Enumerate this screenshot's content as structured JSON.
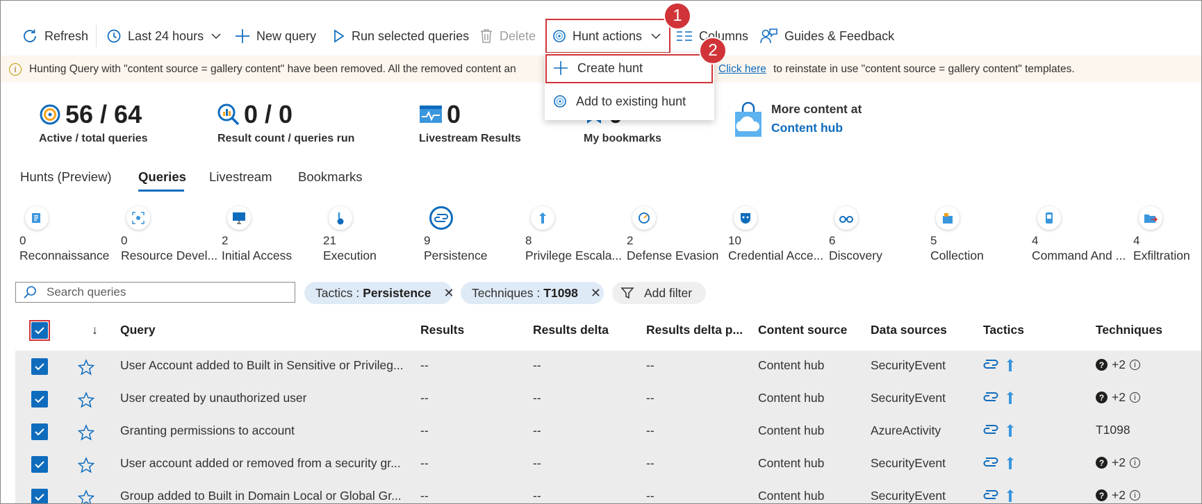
{
  "toolbar": {
    "refresh": "Refresh",
    "time_range": "Last 24 hours",
    "new_query": "New query",
    "run_selected": "Run selected queries",
    "delete": "Delete",
    "hunt_actions": "Hunt actions",
    "columns": "Columns",
    "guides": "Guides & Feedback"
  },
  "callouts": [
    "1",
    "2"
  ],
  "banner": {
    "text_before": "Hunting Query with \"content source = gallery content\" have been removed. All the removed content an",
    "link": "Click here",
    "text_after": "to reinstate in use \"content source = gallery content\" templates."
  },
  "hunt_menu": {
    "items": [
      "Create hunt",
      "Add to existing hunt"
    ]
  },
  "stats": {
    "active": {
      "value": "56 / 64",
      "label": "Active / total queries"
    },
    "results": {
      "value": "0 / 0",
      "label": "Result count / queries run"
    },
    "livestream": {
      "value": "0",
      "label": "Livestream Results"
    },
    "bookmarks": {
      "value": "0",
      "label": "My bookmarks"
    },
    "content_hub": {
      "line1": "More content at",
      "link": "Content hub"
    }
  },
  "tabs": [
    "Hunts (Preview)",
    "Queries",
    "Livestream",
    "Bookmarks"
  ],
  "active_tab": "Queries",
  "tactics": [
    {
      "count": "0",
      "name": "Reconnaissance",
      "icon": "reconnaissance-icon"
    },
    {
      "count": "0",
      "name": "Resource Devel...",
      "icon": "resource-development-icon"
    },
    {
      "count": "2",
      "name": "Initial Access",
      "icon": "initial-access-icon"
    },
    {
      "count": "21",
      "name": "Execution",
      "icon": "execution-icon"
    },
    {
      "count": "9",
      "name": "Persistence",
      "icon": "persistence-icon"
    },
    {
      "count": "8",
      "name": "Privilege Escala...",
      "icon": "privilege-escalation-icon"
    },
    {
      "count": "2",
      "name": "Defense Evasion",
      "icon": "defense-evasion-icon"
    },
    {
      "count": "10",
      "name": "Credential Acce...",
      "icon": "credential-access-icon"
    },
    {
      "count": "6",
      "name": "Discovery",
      "icon": "discovery-icon"
    },
    {
      "count": "5",
      "name": "Collection",
      "icon": "collection-icon"
    },
    {
      "count": "4",
      "name": "Command And ...",
      "icon": "command-and-control-icon"
    },
    {
      "count": "4",
      "name": "Exfiltration",
      "icon": "exfiltration-icon"
    }
  ],
  "filters": {
    "search_placeholder": "Search queries",
    "tactics_key": "Tactics :",
    "tactics_value": "Persistence",
    "techniques_key": "Techniques :",
    "techniques_value": "T1098",
    "add_filter": "Add filter"
  },
  "table": {
    "sort_arrow": "↓",
    "columns": [
      "Query",
      "Results",
      "Results delta",
      "Results delta p...",
      "Content source",
      "Data sources",
      "Tactics",
      "Techniques"
    ],
    "rows": [
      {
        "query": "User Account added to Built in Sensitive or Privileg...",
        "results": "--",
        "delta": "--",
        "delta_pct": "--",
        "source": "Content hub",
        "data_source": "SecurityEvent",
        "techniques": "+2",
        "tech_unknown": true
      },
      {
        "query": "User created by unauthorized user",
        "results": "--",
        "delta": "--",
        "delta_pct": "--",
        "source": "Content hub",
        "data_source": "SecurityEvent",
        "techniques": "+2",
        "tech_unknown": true
      },
      {
        "query": "Granting permissions to account",
        "results": "--",
        "delta": "--",
        "delta_pct": "--",
        "source": "Content hub",
        "data_source": "AzureActivity",
        "techniques": "T1098",
        "tech_unknown": false
      },
      {
        "query": "User account added or removed from a security gr...",
        "results": "--",
        "delta": "--",
        "delta_pct": "--",
        "source": "Content hub",
        "data_source": "SecurityEvent",
        "techniques": "+2",
        "tech_unknown": true
      },
      {
        "query": "Group added to Built in Domain Local or Global Gr...",
        "results": "--",
        "delta": "--",
        "delta_pct": "--",
        "source": "Content hub",
        "data_source": "SecurityEvent",
        "techniques": "+2",
        "tech_unknown": true
      }
    ]
  },
  "colors": {
    "accent": "#0f6cbd",
    "callout": "#d13438",
    "banner_bg": "#fdf6ee",
    "row_bg": "#ececec"
  }
}
